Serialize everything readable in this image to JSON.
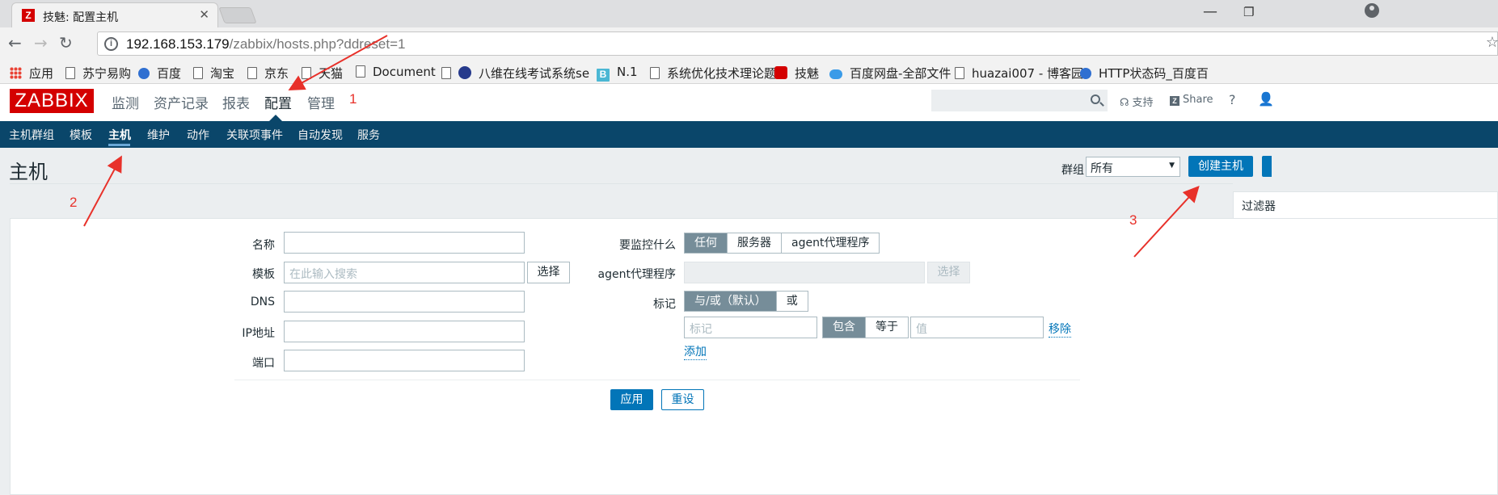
{
  "browser": {
    "tab_favicon": "Z",
    "tab_title": "技魅: 配置主机",
    "tab_close": "✕",
    "minimize": "—",
    "restore": "❐",
    "back": "←",
    "forward": "→",
    "reload": "↻",
    "info": "i",
    "url_host": "192.168.153.179",
    "url_path": "/zabbix/hosts.php?ddreset=1",
    "star": "☆"
  },
  "bookmarks": [
    {
      "label": "应用",
      "icon": "apps-icon"
    },
    {
      "label": "苏宁易购",
      "icon": "page-icon"
    },
    {
      "label": "百度",
      "icon": "baidu-paw-icon"
    },
    {
      "label": "淘宝",
      "icon": "page-icon"
    },
    {
      "label": "京东",
      "icon": "page-icon"
    },
    {
      "label": "天猫",
      "icon": "page-icon"
    },
    {
      "label": "Document",
      "icon": "page-icon"
    },
    {
      "label": "八维在线考试系统se",
      "icon": "globe-icon"
    },
    {
      "label": "N.1",
      "icon": "b-logo-icon"
    },
    {
      "label": "系统优化技术理论题",
      "icon": "page-icon"
    },
    {
      "label": "技魅",
      "icon": "jimei-icon"
    },
    {
      "label": "百度网盘-全部文件",
      "icon": "cloud-icon"
    },
    {
      "label": "huazai007 - 博客园",
      "icon": "page-icon"
    },
    {
      "label": "HTTP状态码_百度百",
      "icon": "baidu-paw-icon"
    }
  ],
  "header": {
    "logo": "ZABBIX",
    "menu": [
      "监测",
      "资产记录",
      "报表",
      "配置",
      "管理"
    ],
    "active_menu": "配置",
    "support": "支持",
    "share": "Share",
    "help": "?"
  },
  "submenu": {
    "items": [
      "主机群组",
      "模板",
      "主机",
      "维护",
      "动作",
      "关联项事件",
      "自动发现",
      "服务"
    ],
    "active": "主机"
  },
  "page": {
    "title": "主机",
    "group_label": "群组",
    "group_value": "所有",
    "create_button": "创建主机",
    "filter_tab": "过滤器"
  },
  "filter": {
    "name_label": "名称",
    "template_label": "模板",
    "template_placeholder": "在此输入搜索",
    "select_button": "选择",
    "dns_label": "DNS",
    "ip_label": "IP地址",
    "port_label": "端口",
    "monitored_by_label": "要监控什么",
    "monitored_by_options": [
      "任何",
      "服务器",
      "agent代理程序"
    ],
    "proxy_label": "agent代理程序",
    "proxy_select_button": "选择",
    "tags_label": "标记",
    "tags_eval_options": [
      "与/或（默认）",
      "或"
    ],
    "tag_placeholder": "标记",
    "tag_operator_options": [
      "包含",
      "等于"
    ],
    "value_placeholder": "值",
    "remove_link": "移除",
    "add_link": "添加",
    "apply_button": "应用",
    "reset_button": "重设"
  },
  "annotations": [
    "1",
    "2",
    "3"
  ],
  "colors": {
    "zabbix_red": "#d40000",
    "nav_blue": "#0a466a",
    "primary_blue": "#0275b8",
    "selected_gray": "#768d99",
    "annotation_red": "#e8312a"
  }
}
